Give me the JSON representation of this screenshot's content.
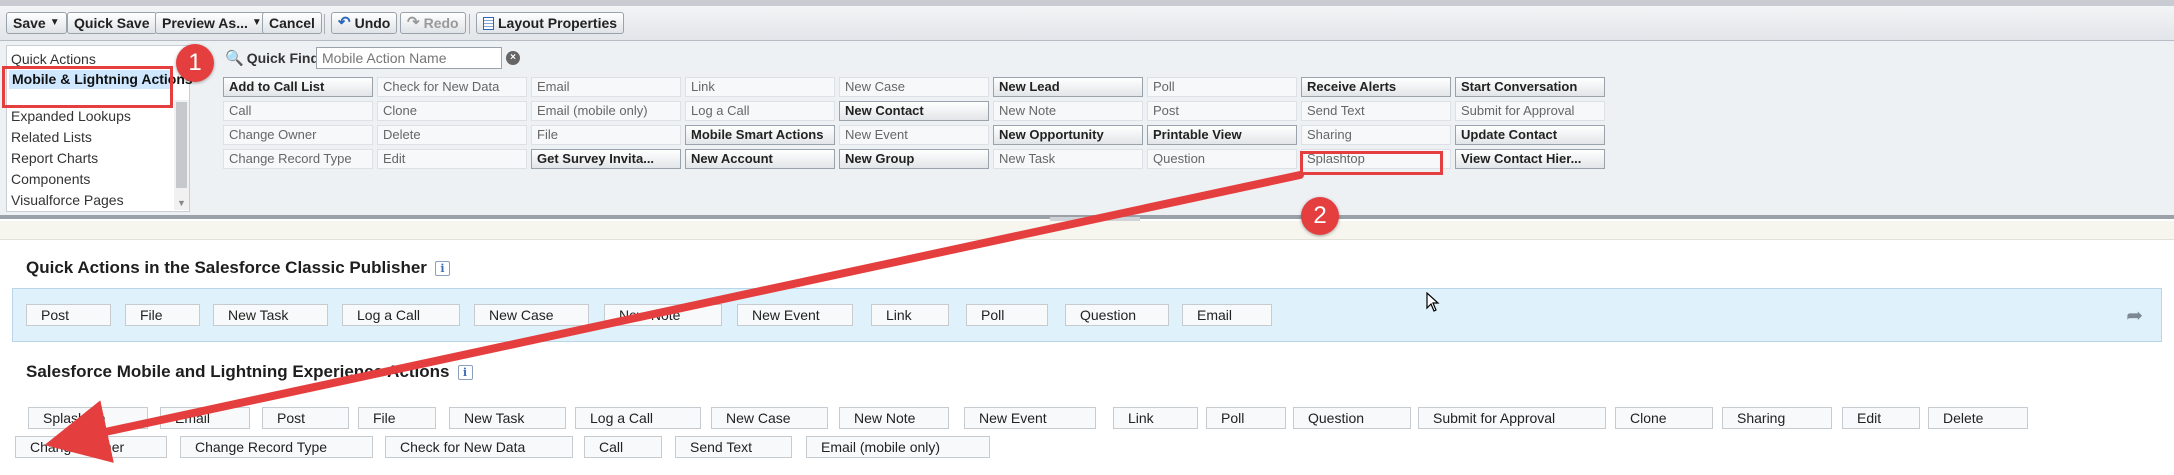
{
  "toolbar": {
    "save": "Save",
    "quick_save": "Quick Save",
    "preview_as": "Preview As...",
    "cancel": "Cancel",
    "undo": "Undo",
    "redo": "Redo",
    "layout_properties": "Layout Properties"
  },
  "palette": {
    "categories": [
      "Quick Actions",
      "Mobile & Lightning Actions",
      "Expanded Lookups",
      "Related Lists",
      "Report Charts",
      "Components",
      "Visualforce Pages"
    ],
    "selected_category": "Mobile & Lightning Actions",
    "quick_find_label": "Quick Find",
    "quick_find_placeholder": "Mobile Action Name",
    "columns": [
      [
        {
          "label": "Add to Call List",
          "avail": true
        },
        {
          "label": "Call",
          "avail": false
        },
        {
          "label": "Change Owner",
          "avail": false
        },
        {
          "label": "Change Record Type",
          "avail": false
        }
      ],
      [
        {
          "label": "Check for New Data",
          "avail": false
        },
        {
          "label": "Clone",
          "avail": false
        },
        {
          "label": "Delete",
          "avail": false
        },
        {
          "label": "Edit",
          "avail": false
        }
      ],
      [
        {
          "label": "Email",
          "avail": false
        },
        {
          "label": "Email (mobile only)",
          "avail": false
        },
        {
          "label": "File",
          "avail": false
        },
        {
          "label": "Get Survey Invita...",
          "avail": true
        }
      ],
      [
        {
          "label": "Link",
          "avail": false
        },
        {
          "label": "Log a Call",
          "avail": false
        },
        {
          "label": "Mobile Smart Actions",
          "avail": true
        },
        {
          "label": "New Account",
          "avail": true
        }
      ],
      [
        {
          "label": "New Case",
          "avail": false
        },
        {
          "label": "New Contact",
          "avail": true
        },
        {
          "label": "New Event",
          "avail": false
        },
        {
          "label": "New Group",
          "avail": true
        }
      ],
      [
        {
          "label": "New Lead",
          "avail": true
        },
        {
          "label": "New Note",
          "avail": false
        },
        {
          "label": "New Opportunity",
          "avail": true
        },
        {
          "label": "New Task",
          "avail": false
        }
      ],
      [
        {
          "label": "Poll",
          "avail": false
        },
        {
          "label": "Post",
          "avail": false
        },
        {
          "label": "Printable View",
          "avail": true
        },
        {
          "label": "Question",
          "avail": false
        }
      ],
      [
        {
          "label": "Receive Alerts",
          "avail": true
        },
        {
          "label": "Send Text",
          "avail": false
        },
        {
          "label": "Sharing",
          "avail": false
        },
        {
          "label": "Splashtop",
          "avail": false
        }
      ],
      [
        {
          "label": "Start Conversation",
          "avail": true
        },
        {
          "label": "Submit for Approval",
          "avail": false
        },
        {
          "label": "Update Contact",
          "avail": true
        },
        {
          "label": "View Contact Hier...",
          "avail": true
        }
      ]
    ]
  },
  "classic_publisher": {
    "title": "Quick Actions in the Salesforce Classic Publisher",
    "items": [
      "Post",
      "File",
      "New Task",
      "Log a Call",
      "New Case",
      "New Note",
      "New Event",
      "Link",
      "Poll",
      "Question",
      "Email"
    ]
  },
  "mobile_actions": {
    "title": "Salesforce Mobile and Lightning Experience Actions",
    "row1": [
      "Splashtop",
      "Email",
      "Post",
      "File",
      "New Task",
      "Log a Call",
      "New Case",
      "New Note",
      "New Event",
      "Link",
      "Poll",
      "Question",
      "Submit for Approval",
      "Clone",
      "Sharing",
      "Edit",
      "Delete"
    ],
    "row2": [
      "Change Owner",
      "Change Record Type",
      "Check for New Data",
      "Call",
      "Send Text",
      "Email (mobile only)"
    ]
  },
  "annotations": {
    "marker1": "1",
    "marker2": "2",
    "accent": "#e53e3e"
  },
  "icons": {
    "undo": "undo-icon",
    "redo": "redo-icon",
    "layout": "layout-properties-icon",
    "search": "search-icon",
    "clear": "clear-search-icon",
    "info": "info-icon"
  }
}
